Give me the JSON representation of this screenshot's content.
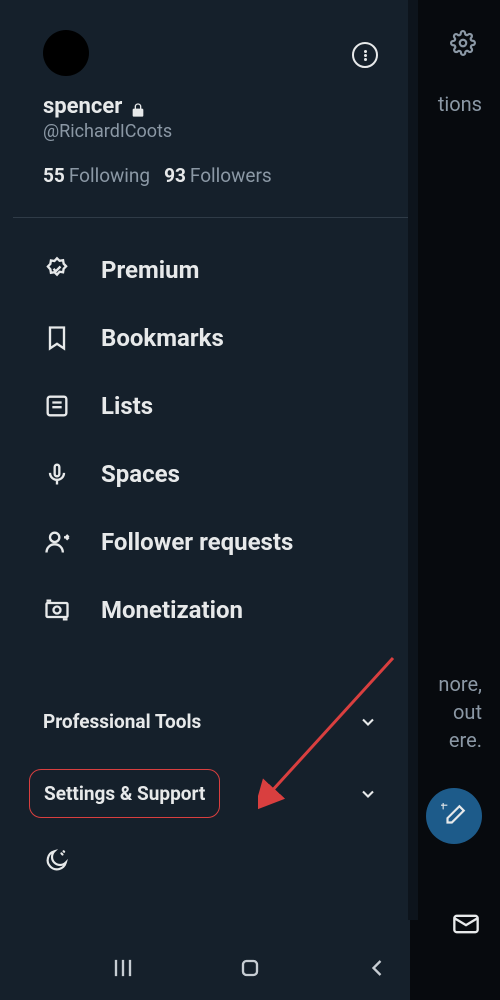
{
  "backdrop": {
    "partial_text_top": "tions",
    "snippet_lines": [
      "nore,",
      "out",
      "ere."
    ]
  },
  "profile": {
    "display_name": "spencer",
    "handle": "@RichardICoots",
    "following_count": "55",
    "following_label": "Following",
    "followers_count": "93",
    "followers_label": "Followers"
  },
  "nav": {
    "premium": "Premium",
    "bookmarks": "Bookmarks",
    "lists": "Lists",
    "spaces": "Spaces",
    "follower_requests": "Follower requests",
    "monetization": "Monetization"
  },
  "sections": {
    "professional_tools": "Professional Tools",
    "settings_support": "Settings & Support"
  },
  "colors": {
    "accent_highlight": "#d93f3f",
    "background": "#15202b",
    "muted": "#8b98a5"
  }
}
